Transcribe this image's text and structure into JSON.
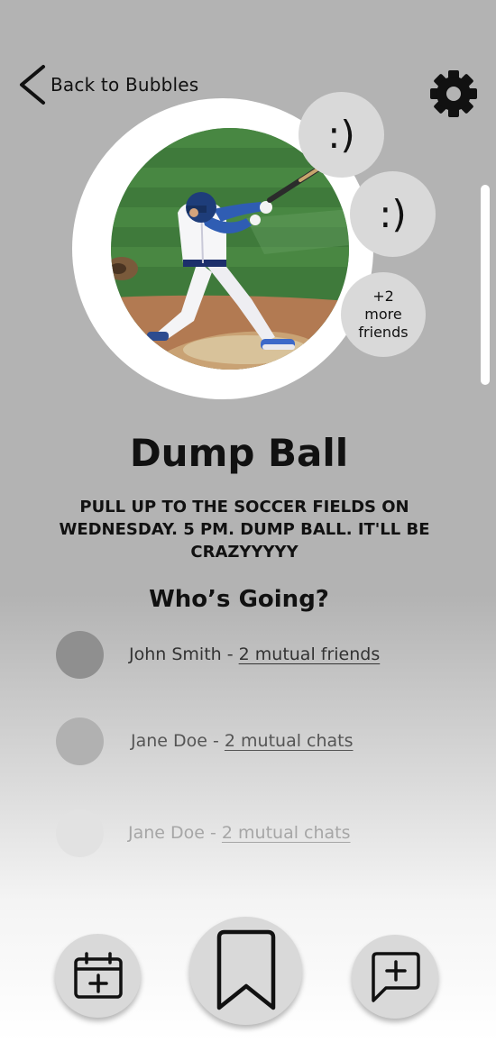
{
  "header": {
    "back_label": "Back to Bubbles",
    "back_icon": "chevron-left-icon",
    "settings_icon": "gear-icon"
  },
  "hero": {
    "photo_alt": "baseball batter swinging",
    "friend_avatars": [
      ":)",
      ":)"
    ],
    "more_friends": {
      "count": "+2",
      "line2": "more",
      "line3": "friends"
    }
  },
  "event": {
    "title": "Dump Ball",
    "description": "PULL UP TO THE SOCCER FIELDS ON WEDNESDAY. 5 PM. DUMP BALL. IT'LL BE CRAZYYYYY"
  },
  "attendees": {
    "heading": "Who’s Going?",
    "items": [
      {
        "name": "John Smith",
        "sep": " - ",
        "mutual": "2 mutual friends"
      },
      {
        "name": "Jane Doe",
        "sep": " - ",
        "mutual": "2 mutual chats"
      },
      {
        "name": "Jane Doe",
        "sep": " - ",
        "mutual": "2 mutual chats"
      }
    ]
  },
  "bottom_bar": {
    "buttons": [
      "calendar-add-icon",
      "bookmark-icon",
      "message-add-icon"
    ]
  }
}
